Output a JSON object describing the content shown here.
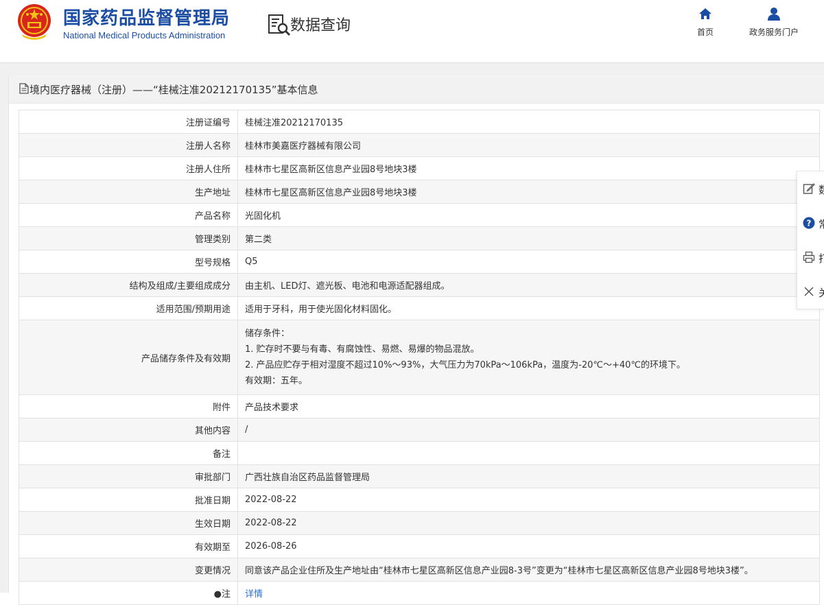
{
  "header": {
    "org_name_cn": "国家药品监督管理局",
    "org_name_en": "National Medical Products Administration",
    "query_title": "数据查询",
    "nav": [
      {
        "label": "首页",
        "icon": "home-icon"
      },
      {
        "label": "政务服务门户",
        "icon": "user-icon"
      }
    ]
  },
  "panel": {
    "title": "境内医疗器械（注册）——“桂械注准20212170135”基本信息"
  },
  "rows": [
    {
      "label": "注册证编号",
      "value": "桂械注准20212170135"
    },
    {
      "label": "注册人名称",
      "value": "桂林市美嘉医疗器械有限公司"
    },
    {
      "label": "注册人住所",
      "value": "桂林市七星区高新区信息产业园8号地块3楼"
    },
    {
      "label": "生产地址",
      "value": "桂林市七星区高新区信息产业园8号地块3楼"
    },
    {
      "label": "产品名称",
      "value": "光固化机"
    },
    {
      "label": "管理类别",
      "value": "第二类"
    },
    {
      "label": "型号规格",
      "value": "Q5"
    },
    {
      "label": "结构及组成/主要组成成分",
      "value": "由主机、LED灯、遮光板、电池和电源适配器组成。"
    },
    {
      "label": "适用范围/预期用途",
      "value": "适用于牙科，用于使光固化材料固化。"
    },
    {
      "label": "产品储存条件及有效期",
      "lines": [
        "储存条件：",
        "1. 贮存时不要与有毒、有腐蚀性、易燃、易爆的物品混放。",
        "2. 产品应贮存于相对湿度不超过10%～93%，大气压力为70kPa～106kPa，温度为-20℃～+40℃的环境下。",
        "有效期：五年。"
      ]
    },
    {
      "label": "附件",
      "value": "产品技术要求"
    },
    {
      "label": "其他内容",
      "value": "/"
    },
    {
      "label": "备注",
      "value": ""
    },
    {
      "label": "审批部门",
      "value": "广西壮族自治区药品监督管理局"
    },
    {
      "label": "批准日期",
      "value": "2022-08-22"
    },
    {
      "label": "生效日期",
      "value": "2022-08-22"
    },
    {
      "label": "有效期至",
      "value": "2026-08-26"
    },
    {
      "label": "变更情况",
      "value": "同意该产品企业住所及生产地址由“桂林市七星区高新区信息产业园8-3号”变更为“桂林市七星区高新区信息产业园8号地块3楼”。"
    },
    {
      "label": "●注",
      "value": "详情",
      "link": true
    }
  ],
  "float_toolbar": [
    {
      "label": "数",
      "icon": "edit-icon"
    },
    {
      "label": "常",
      "icon": "help-icon"
    },
    {
      "label": "打",
      "icon": "print-icon"
    },
    {
      "label": "关",
      "icon": "close-icon"
    }
  ],
  "colors": {
    "brand_blue": "#1b4ea3",
    "link_blue": "#2a6fd6",
    "row_alt": "#f6f6f6",
    "border": "#e2e2e2"
  }
}
